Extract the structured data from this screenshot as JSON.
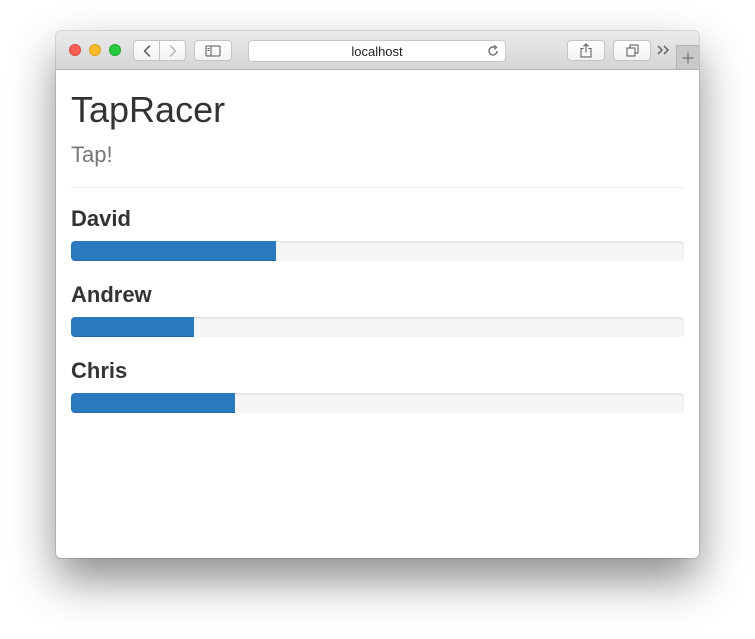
{
  "browser": {
    "url": "localhost"
  },
  "page": {
    "title": "TapRacer",
    "subtitle": "Tap!"
  },
  "racers": [
    {
      "name": "David",
      "progress_percent": 33.5
    },
    {
      "name": "Andrew",
      "progress_percent": 20
    },
    {
      "name": "Chris",
      "progress_percent": 26.7
    }
  ],
  "colors": {
    "progress_bar": "#2a7abf",
    "progress_track": "#f5f5f5",
    "title_text": "#333333",
    "subtitle_text": "#777777"
  },
  "icons": {
    "back": "chevron-left-icon",
    "forward": "chevron-right-icon",
    "sidebar": "sidebar-icon",
    "reload": "reload-icon",
    "share": "share-icon",
    "tabs": "tabs-icon",
    "more": "double-chevron-right-icon",
    "new_tab": "plus-icon"
  }
}
